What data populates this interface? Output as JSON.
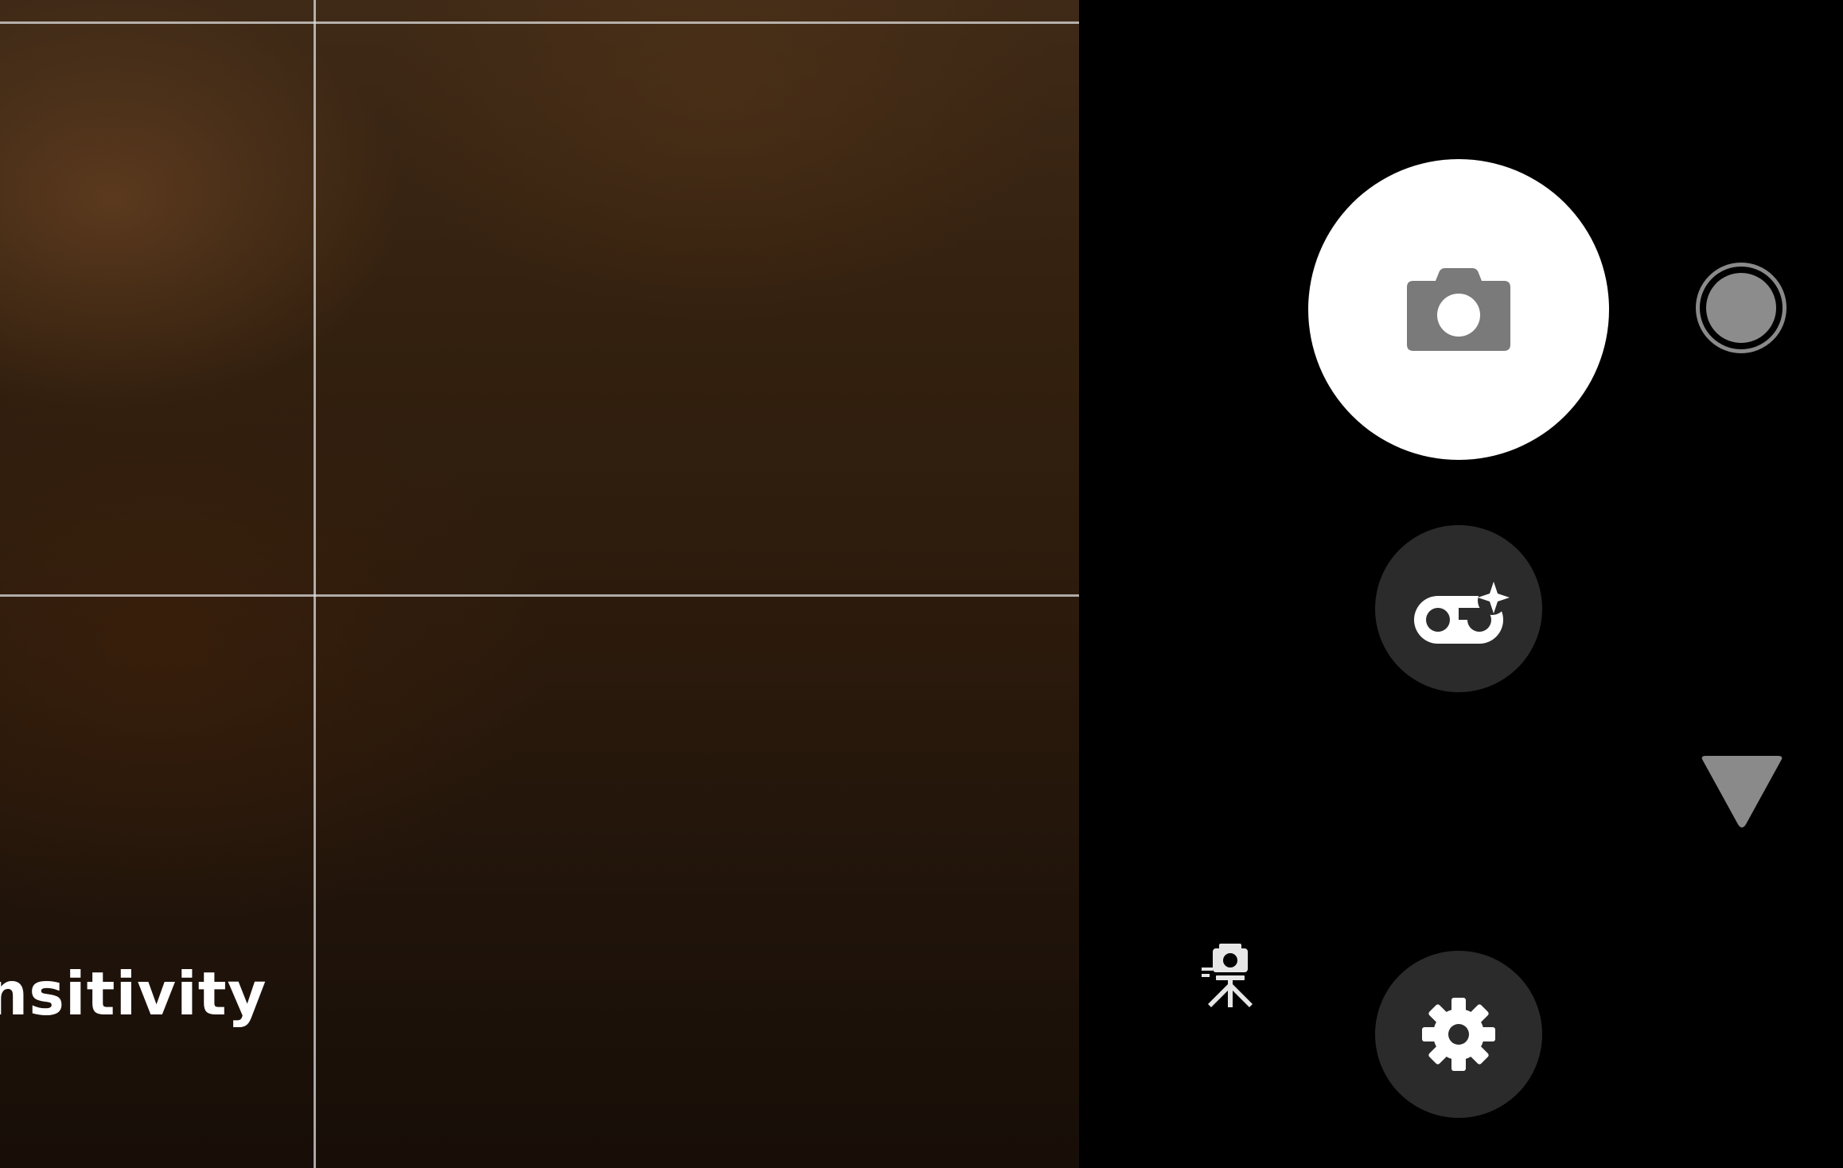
{
  "viewfinder": {
    "label": "ensitivity"
  },
  "controls": {
    "shutter": {
      "icon": "camera-icon"
    },
    "thumbnail": {
      "icon": "last-photo-thumbnail"
    },
    "mode": {
      "icon": "mode-sparkle-icon"
    },
    "expand": {
      "icon": "triangle-down-icon"
    },
    "tripod": {
      "icon": "tripod-camera-icon"
    },
    "settings": {
      "icon": "gear-icon"
    }
  },
  "colors": {
    "panel_background": "#000000",
    "shutter_fill": "#ffffff",
    "icon_gray": "#7a7a7a",
    "button_dark": "#2b2b2b",
    "grid_line": "#dcdcdc"
  }
}
